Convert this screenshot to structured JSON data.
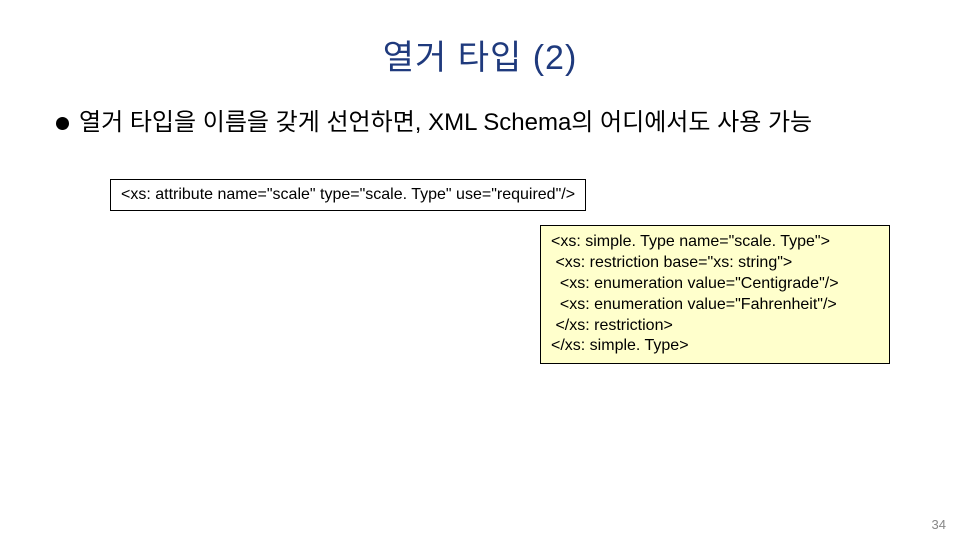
{
  "slide": {
    "title": "열거 타입 (2)",
    "bullet_text": "열거 타입을 이름을 갖게 선언하면, XML Schema의 어디에서도 사용 가능",
    "code1": "<xs: attribute name=\"scale\" type=\"scale. Type\" use=\"required\"/>",
    "code2": {
      "l1": "<xs: simple. Type name=\"scale. Type\">",
      "l2": " <xs: restriction base=\"xs: string\">",
      "l3": "  <xs: enumeration value=\"Centigrade\"/>",
      "l4": "  <xs: enumeration value=\"Fahrenheit\"/>",
      "l5": " </xs: restriction>",
      "l6": "</xs: simple. Type>"
    },
    "page_number": "34"
  }
}
